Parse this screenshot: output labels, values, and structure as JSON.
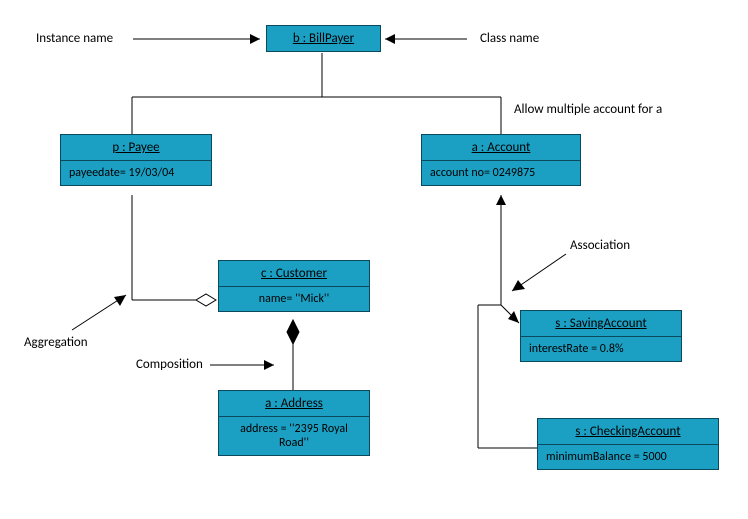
{
  "labels": {
    "instanceName": "Instance name",
    "className": "Class name",
    "allowMultiple": "Allow multiple account for a",
    "association": "Association",
    "aggregation": "Aggregation",
    "composition": "Composition"
  },
  "objects": {
    "billPayer": {
      "header": "b : BillPayer"
    },
    "payee": {
      "header": "p : Payee",
      "attr": "payeedate= 19/03/04"
    },
    "account": {
      "header": "a : Account",
      "attr": "account no= 0249875"
    },
    "customer": {
      "header": "c : Customer",
      "attr": "name= ''Mick''"
    },
    "address": {
      "header": "a : Address",
      "attr": "address = ''2395 Royal Road''"
    },
    "saving": {
      "header": "s : SavingAccount",
      "attr": "interestRate = 0.8%"
    },
    "checking": {
      "header": "s : CheckingAccount",
      "attr": "minimumBalance = 5000"
    }
  }
}
